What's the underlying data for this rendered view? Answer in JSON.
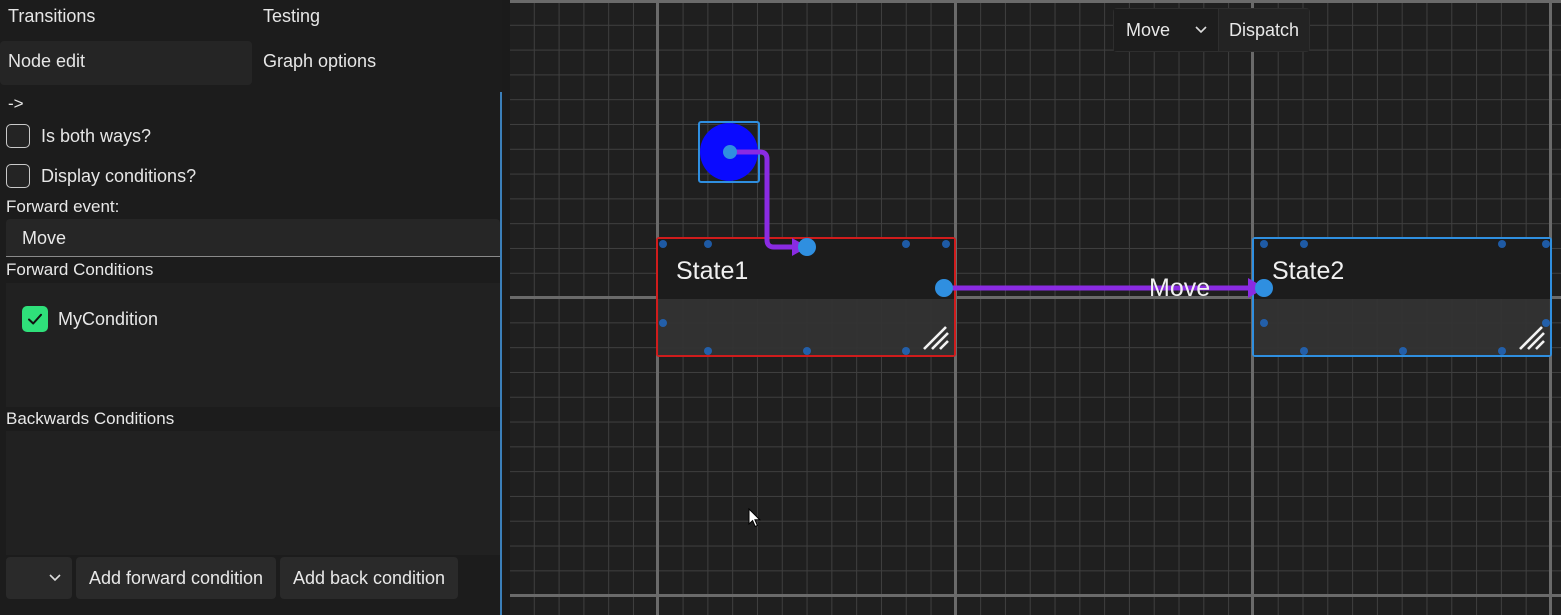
{
  "tabs": {
    "transitions": "Transitions",
    "testing": "Testing",
    "node_edit": "Node edit",
    "graph_options": "Graph options"
  },
  "transition_editor": {
    "direction_label": "->",
    "is_both_ways_label": "Is both ways?",
    "is_both_ways_checked": false,
    "display_conditions_label": "Display conditions?",
    "display_conditions_checked": false,
    "forward_event_label": "Forward event:",
    "forward_event_value": "Move",
    "forward_conditions_label": "Forward Conditions",
    "forward_conditions": [
      {
        "label": "MyCondition",
        "checked": true
      }
    ],
    "backwards_conditions_label": "Backwards Conditions",
    "backwards_conditions": [],
    "add_forward_button": "Add forward condition",
    "add_back_button": "Add back condition"
  },
  "graph": {
    "toolbar": {
      "event_select_value": "Move",
      "dispatch_button": "Dispatch"
    },
    "nodes": {
      "state1": {
        "title": "State1",
        "border_color": "#d01c1c"
      },
      "state2": {
        "title": "State2",
        "border_color": "#2f8fe0"
      }
    },
    "edge_label": "Move",
    "edge_color": "#8a2be2",
    "entry_color": "#0a0aff"
  },
  "colors": {
    "accent": "#3b7fb9",
    "check_green": "#2fe07a",
    "port_blue": "#2f8fe0"
  }
}
